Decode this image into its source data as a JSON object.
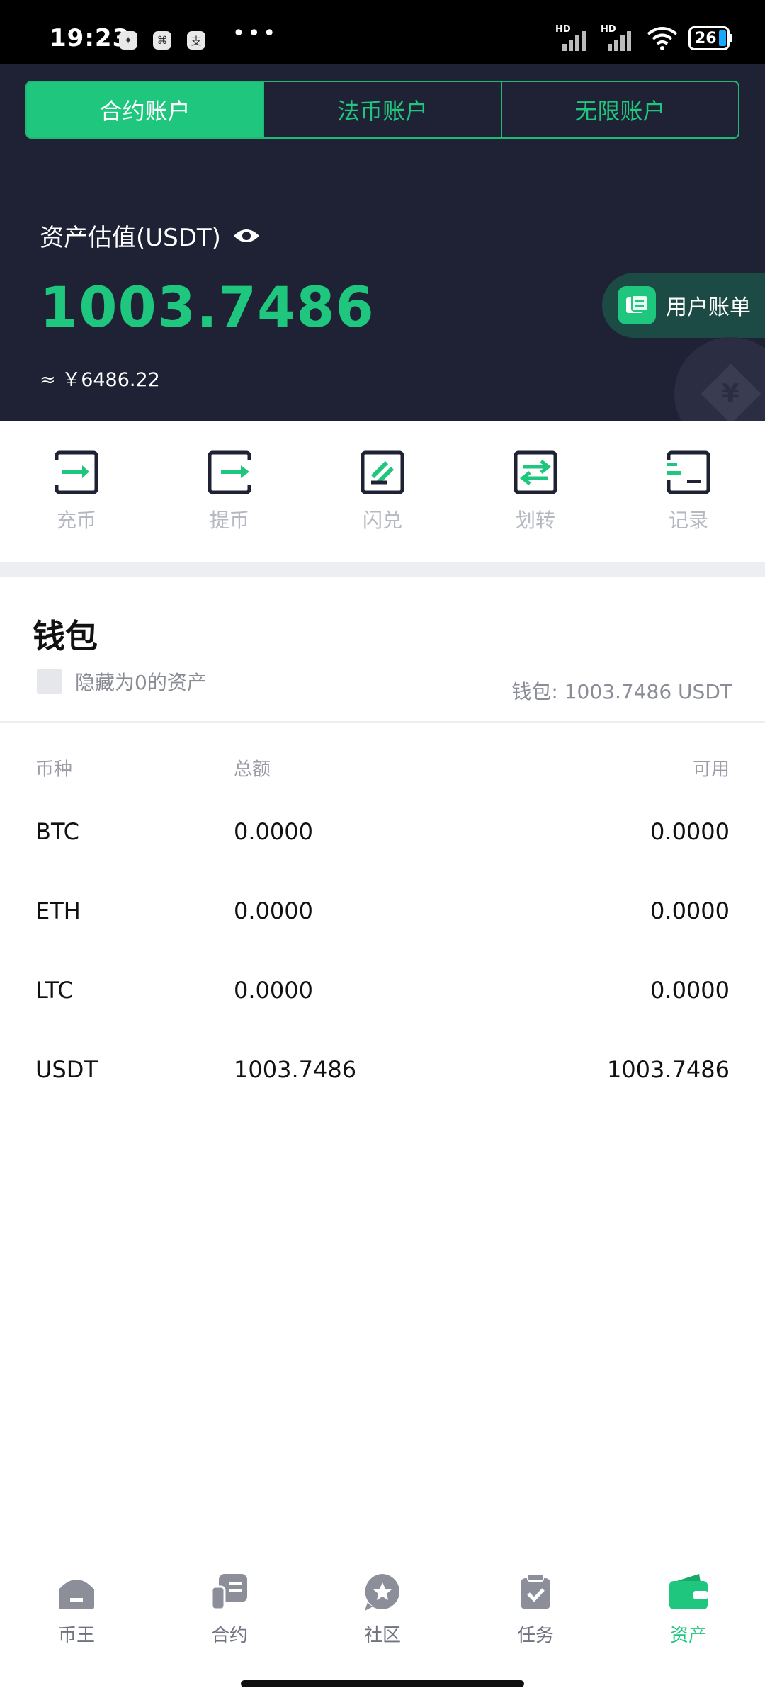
{
  "status_bar": {
    "time": "19:23",
    "hd1": "HD",
    "hd2": "HD",
    "battery": "26"
  },
  "tabs": [
    {
      "label": "合约账户",
      "active": true
    },
    {
      "label": "法币账户",
      "active": false
    },
    {
      "label": "无限账户",
      "active": false
    }
  ],
  "asset": {
    "label": "资产估值(USDT)",
    "value": "1003.7486",
    "cny": "≈ ￥6486.22",
    "bill_label": "用户账单"
  },
  "actions": [
    {
      "label": "充币",
      "icon": "deposit-icon"
    },
    {
      "label": "提币",
      "icon": "withdraw-icon"
    },
    {
      "label": "闪兑",
      "icon": "flash-swap-icon"
    },
    {
      "label": "划转",
      "icon": "transfer-icon"
    },
    {
      "label": "记录",
      "icon": "records-icon"
    }
  ],
  "wallet": {
    "title": "钱包",
    "hide_zero_label": "隐藏为0的资产",
    "total": "钱包: 1003.7486 USDT",
    "columns": [
      "币种",
      "总额",
      "可用"
    ],
    "rows": [
      [
        "BTC",
        "0.0000",
        "0.0000"
      ],
      [
        "ETH",
        "0.0000",
        "0.0000"
      ],
      [
        "LTC",
        "0.0000",
        "0.0000"
      ],
      [
        "USDT",
        "1003.7486",
        "1003.7486"
      ]
    ]
  },
  "nav": [
    {
      "label": "币王",
      "icon": "home-icon"
    },
    {
      "label": "合约",
      "icon": "contract-icon"
    },
    {
      "label": "社区",
      "icon": "community-icon"
    },
    {
      "label": "任务",
      "icon": "task-icon"
    },
    {
      "label": "资产",
      "icon": "wallet-icon",
      "active": true
    }
  ],
  "colors": {
    "accent": "#1fc67e",
    "header_bg": "#1f2235",
    "muted": "#8a8d96"
  }
}
